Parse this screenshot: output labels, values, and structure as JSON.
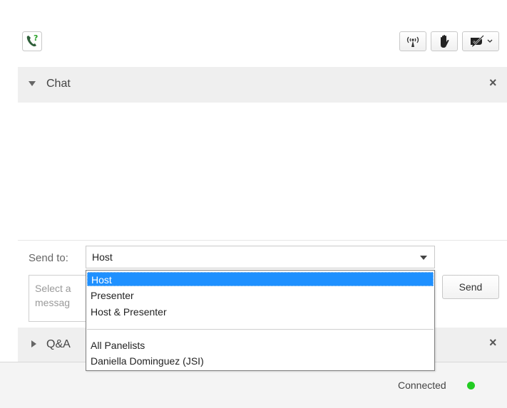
{
  "toolbar": {
    "help_call_icon": "phone-question-icon",
    "broadcast_icon": "broadcast-icon",
    "raise_hand_icon": "hand-icon",
    "status_icon": "status-check-icon"
  },
  "chat": {
    "title": "Chat",
    "close": "×",
    "send_to_label": "Send to:",
    "send_to_value": "Host",
    "message_placeholder": "Select a message",
    "message_placeholder_line1": "Select a",
    "message_placeholder_line2": "messag",
    "send_label": "Send"
  },
  "dropdown": {
    "options": [
      {
        "label": "Host",
        "selected": true
      },
      {
        "label": "Presenter"
      },
      {
        "label": "Host & Presenter"
      },
      {
        "label": "All Panelists"
      },
      {
        "label": "Daniella Dominguez (JSI)"
      }
    ]
  },
  "qa": {
    "title": "Q&A",
    "close": "×"
  },
  "status": {
    "text": "Connected",
    "color": "#22cc22"
  }
}
